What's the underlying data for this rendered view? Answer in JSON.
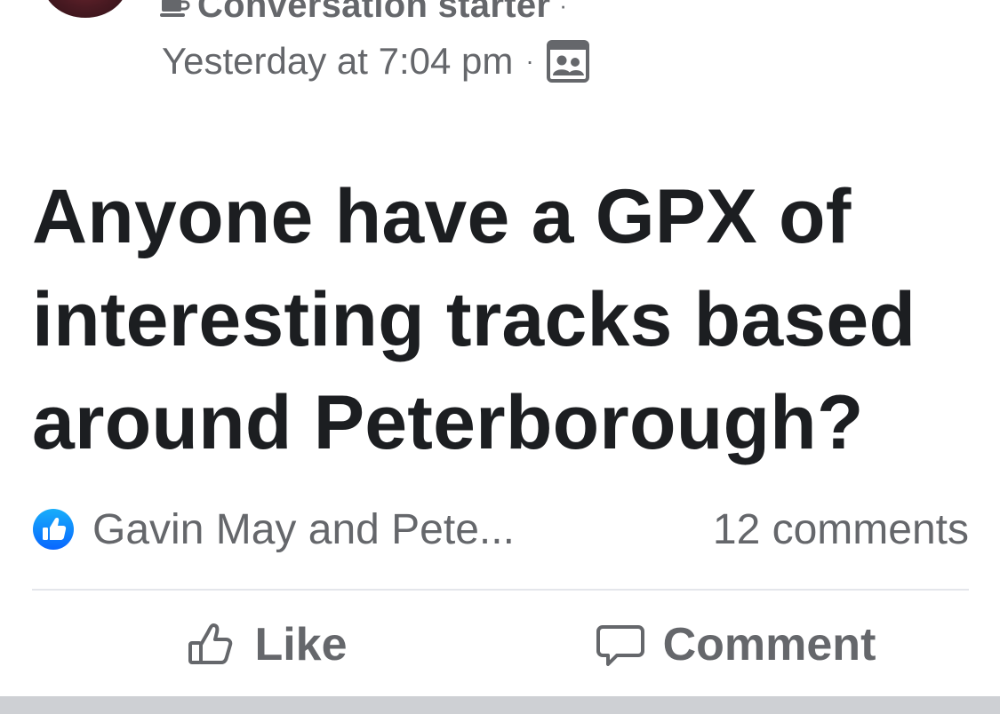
{
  "post": {
    "badge": {
      "label": "Conversation starter",
      "icon": "coffee-cup-icon",
      "separator": "·"
    },
    "meta": {
      "time": "Yesterday at 7:04 pm",
      "separator": "·",
      "audience_icon": "group-audience-icon"
    },
    "text": "Anyone have a GPX of interesting tracks based around Peterborough?",
    "reactions": {
      "icon": "like-reaction-icon",
      "reactors": "Gavin May and Pete...",
      "comments": "12 comments"
    },
    "actions": {
      "like_label": "Like",
      "comment_label": "Comment"
    }
  },
  "colors": {
    "secondary_text": "#65676b",
    "primary_text": "#1c1e21",
    "like_blue": "#1877f2",
    "divider": "#e4e6eb",
    "bottom_band": "#ced0d4"
  }
}
